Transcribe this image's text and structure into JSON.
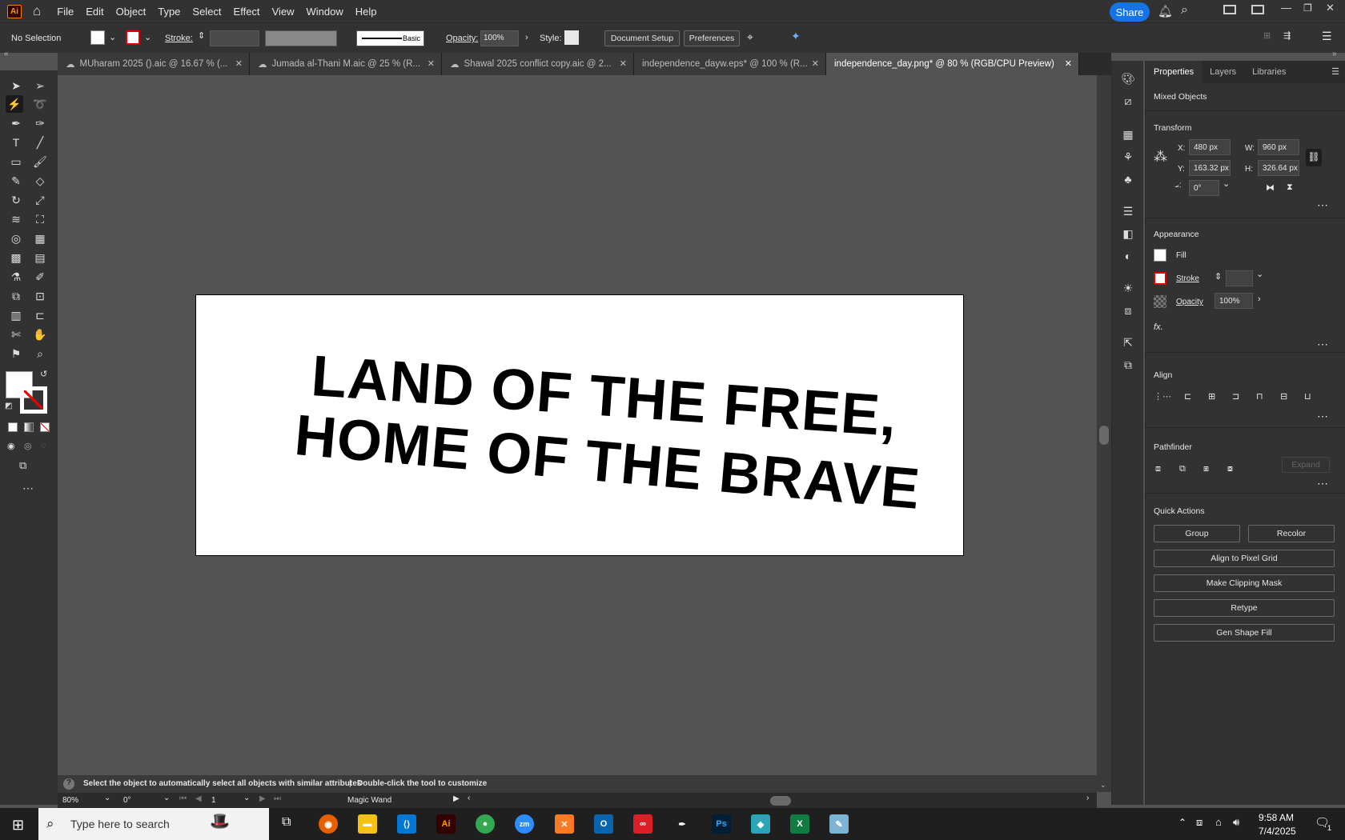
{
  "menu": {
    "app_icon": "Ai",
    "items": [
      "File",
      "Edit",
      "Object",
      "Type",
      "Select",
      "Effect",
      "View",
      "Window",
      "Help"
    ],
    "share": "Share"
  },
  "control_bar": {
    "selection": "No Selection",
    "stroke_label": "Stroke:",
    "brush": "Basic",
    "opacity_label": "Opacity:",
    "opacity_value": "100%",
    "style_label": "Style:",
    "document_setup": "Document Setup",
    "preferences": "Preferences"
  },
  "tabs": [
    {
      "label": "MUharam 2025 ().aic @ 16.67 % (...",
      "active": false
    },
    {
      "label": "Jumada al-Thani M.aic @ 25 % (R...",
      "active": false
    },
    {
      "label": "Shawal 2025 conflict copy.aic @ 2...",
      "active": false
    },
    {
      "label": "independence_dayw.eps* @ 100 % (R...",
      "active": false
    },
    {
      "label": "independence_day.png* @ 80 % (RGB/CPU Preview)",
      "active": true
    }
  ],
  "artboard": {
    "line1": "LAND OF THE FREE,",
    "line2": "HOME OF THE BRAVE"
  },
  "properties": {
    "tabs": [
      "Properties",
      "Layers",
      "Libraries"
    ],
    "mixed": "Mixed Objects",
    "transform_title": "Transform",
    "x_label": "X:",
    "x": "480 px",
    "w_label": "W:",
    "w": "960 px",
    "y_label": "Y:",
    "y": "163.32 px",
    "h_label": "H:",
    "h": "326.64 px",
    "angle": "0°",
    "appearance_title": "Appearance",
    "fill": "Fill",
    "stroke": "Stroke",
    "opacity": "Opacity",
    "opacity_value": "100%",
    "fx": "fx.",
    "align_title": "Align",
    "pathfinder_title": "Pathfinder",
    "expand": "Expand",
    "quick_title": "Quick Actions",
    "group": "Group",
    "recolor": "Recolor",
    "align_pixel": "Align to Pixel Grid",
    "clipping": "Make Clipping Mask",
    "retype": "Retype",
    "gen_fill": "Gen Shape Fill"
  },
  "status": {
    "hint": "Select the object to automatically select all objects with similar attributes",
    "hint2": "Double-click the tool to customize",
    "zoom": "80%",
    "rotation": "0°",
    "artboard_num": "1",
    "tool": "Magic Wand"
  },
  "taskbar": {
    "search": "Type here to search",
    "time": "9:58 AM",
    "date": "7/4/2025",
    "notif": "1"
  }
}
